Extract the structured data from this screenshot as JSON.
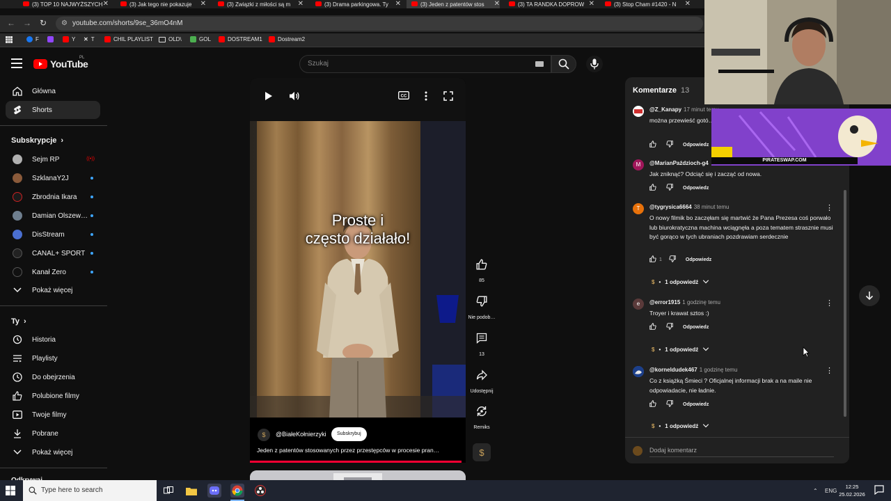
{
  "browser": {
    "tabs": [
      {
        "title": "(3) TOP 10 NAJWYŻSZYCH"
      },
      {
        "title": "(3) Jak tego nie pokazuje"
      },
      {
        "title": "(3) Związki z miłości są m"
      },
      {
        "title": "(3) Drama parkingowa. Ty"
      },
      {
        "title": "(3) Jeden z patentów stos"
      },
      {
        "title": "(3) TA RANDKA DOPROW"
      },
      {
        "title": "(3) Stop Cham #1420 - N"
      }
    ],
    "url": "youtube.com/shorts/9se_36mO4nM",
    "bookmarks": [
      {
        "label": "F",
        "color": "#1877f2"
      },
      {
        "label": "",
        "color": "#9146ff"
      },
      {
        "label": "Y",
        "color": "#ff0000"
      },
      {
        "label": "T",
        "color": "#ffffff"
      },
      {
        "label": "CHIL PLAYLIST",
        "color": "#ff0000"
      },
      {
        "label": "OLD\\",
        "color": "#bbbbbb"
      },
      {
        "label": "GOL",
        "color": "#4caf50"
      },
      {
        "label": "DOSTREAM1",
        "color": "#ff0000"
      },
      {
        "label": "Dostream2",
        "color": "#ff0000"
      }
    ]
  },
  "yt": {
    "logo": "YouTube",
    "country": "PL",
    "search_placeholder": "Szukaj"
  },
  "sidebar": {
    "main": [
      {
        "label": "Główna",
        "icon": "home-icon"
      },
      {
        "label": "Shorts",
        "icon": "shorts-icon",
        "active": true
      }
    ],
    "subs_title": "Subskrypcje",
    "subs": [
      {
        "label": "Sejm RP",
        "color": "#b0b0b0",
        "badge": "live"
      },
      {
        "label": "SzklanaY2J",
        "color": "#8a5a3a",
        "badge": "dot"
      },
      {
        "label": "Zbrodnia Ikara",
        "color": "#1a1a1a",
        "badge": "dot"
      },
      {
        "label": "Damian Olszews…",
        "color": "#6f7f8f",
        "badge": "dot"
      },
      {
        "label": "DisStream",
        "color": "#4a6fd0",
        "badge": "dot"
      },
      {
        "label": "CANAL+ SPORT",
        "color": "#222222",
        "badge": "dot"
      },
      {
        "label": "Kanał Zero",
        "color": "#111111",
        "badge": "dot"
      }
    ],
    "show_more": "Pokaż więcej",
    "you_title": "Ty",
    "you": [
      {
        "label": "Historia",
        "icon": "history-icon"
      },
      {
        "label": "Playlisty",
        "icon": "playlist-icon"
      },
      {
        "label": "Do obejrzenia",
        "icon": "clock-icon"
      },
      {
        "label": "Polubione filmy",
        "icon": "like-icon"
      },
      {
        "label": "Twoje filmy",
        "icon": "video-icon"
      },
      {
        "label": "Pobrane",
        "icon": "download-icon"
      }
    ],
    "show_more2": "Pokaż więcej",
    "cut_label": "Odkrywaj"
  },
  "short": {
    "caption_line1": "Proste i",
    "caption_line2": "często działało!",
    "channel": "@BiałeKołnierzyki",
    "subscribe": "Subskrybuj",
    "title": "Jeden z patentów stosowanych przez przestępców w procesie pran…",
    "likes": "85",
    "dislike_label": "Nie podob…",
    "comments": "13",
    "share_label": "Udostępnij",
    "remix_label": "Remiks"
  },
  "comments": {
    "title": "Komentarze",
    "count": "13",
    "items": [
      {
        "author": "@Z_Kanapy",
        "time": "17 minut temu",
        "text": "można przewieść gotó… co itp jadę po auto i p…",
        "likes": "",
        "reply": "Odpowiedz",
        "color": "#d03030",
        "initial": ""
      },
      {
        "author": "@MarianPaździoch-g4",
        "time": "",
        "text": "Jak zniknąć? Odciąć się i zacząć od nowa.",
        "likes": "",
        "reply": "Odpowiedz",
        "color": "#a0165a",
        "initial": "M"
      },
      {
        "author": "@tygrysica6664",
        "time": "38 minut temu",
        "text": "O nowy filmik bo zaczęłam się martwić że Pana Prezesa coś porwało lub biurokratyczna machina wciągnęła a poza tematem strasznie musi być gorąco w tych ubraniach pozdrawiam serdecznie",
        "likes": "1",
        "reply": "Odpowiedz",
        "color": "#e8710a",
        "initial": "T",
        "replies": "1 odpowiedź"
      },
      {
        "author": "@error1915",
        "time": "1 godzinę temu",
        "text": "Troyer i krawat sztos :)",
        "likes": "",
        "reply": "Odpowiedz",
        "color": "#5a3a3a",
        "initial": "e",
        "replies": "1 odpowiedź"
      },
      {
        "author": "@korneldudek467",
        "time": "1 godzinę temu",
        "text": "Co z książką Śmieci ? Oficjalnej informacji brak a na maile nie odpowiadacie, nie ładnie.",
        "likes": "",
        "reply": "Odpowiedz",
        "color": "#3a6fd0",
        "initial": "",
        "replies": "1 odpowiedź"
      }
    ],
    "add_placeholder": "Dodaj komentarz"
  },
  "overlay": {
    "banner_text": "PIRATESWAP.COM"
  },
  "taskbar": {
    "search_placeholder": "Type here to search",
    "lang": "ENG",
    "time": "12:25",
    "date": "25.02.2026"
  }
}
